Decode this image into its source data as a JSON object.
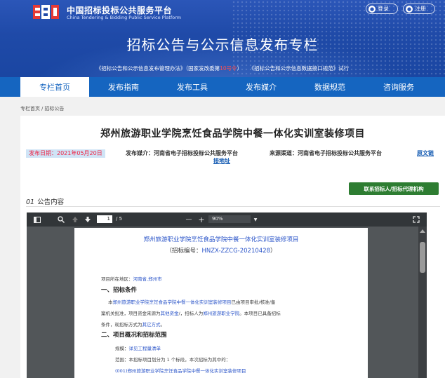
{
  "header": {
    "site_name_cn": "中国招标投标公共服务平台",
    "site_name_en": "China Tendering & Bidding Public Service Platform",
    "login": "登录",
    "register": "注册",
    "title": "招标公告与公示信息发布专栏",
    "policy_part1": "《招标公告和公示信息发布管理办法》（国家发改委第",
    "policy_red": "10号令",
    "policy_part2": "）",
    "policy_part3": "《招标公告和公示信息数据接口规范》试行"
  },
  "nav": {
    "items": [
      {
        "label": "专栏首页",
        "active": true
      },
      {
        "label": "发布指南",
        "active": false
      },
      {
        "label": "发布工具",
        "active": false
      },
      {
        "label": "发布媒介",
        "active": false
      },
      {
        "label": "数据规范",
        "active": false
      },
      {
        "label": "咨询服务",
        "active": false
      }
    ]
  },
  "breadcrumb": {
    "home": "专栏首页",
    "sep": "/",
    "current": "招标公告"
  },
  "article": {
    "title": "郑州旅游职业学院烹饪食品学院中餐一体化实训室装修项目",
    "publish_date": "发布日期：2021年05月20日",
    "source_label": "发布媒介：河南省电子招标投标公共服务平台",
    "channel_label": "来源渠道：河南省电子招标投标公共服务平台",
    "original_link": "原文链",
    "address_link": "接地址",
    "contact_button": "联系招标人/招标代理机构",
    "section_num": "01",
    "section_title": "公告内容"
  },
  "viewer": {
    "page_current": "1",
    "page_total": "/ 5",
    "zoom": "90%",
    "minus": "—",
    "plus": "+",
    "doc": {
      "title": "郑州旅游职业学院烹饪食品学院中餐一体化实训室装修项目",
      "code_prefix": "（招标编号：",
      "code": "HNZX-ZZCG-20210428",
      "code_suffix": "）",
      "location_label": "项目所在地区：",
      "location": "河南省,郑州市",
      "sec1": "一、招标条件",
      "cond1_a": "本",
      "cond1_proj": "郑州旅游职业学院烹饪食品学院中餐一体化实训室装修项目",
      "cond1_b": "已由项目审批/核准/备",
      "cond2_a": "案机关批准，项目资金来源为",
      "cond2_fund": "其他资金",
      "cond2_b": "/，招标人为",
      "cond2_owner": "郑州旅游职业学院",
      "cond2_c": "。本项目已具备招标",
      "cond3_a": "条件，现招标方式为",
      "cond3_method": "其它方式",
      "cond3_b": "。",
      "sec2": "二、项目概况和招标范围",
      "scale_label": "规模：",
      "scale": "详见工程量清单",
      "scope_line": "范围：本招标项目划分为 1 个标段，本次招标为其中的：",
      "lot": "(001)郑州旅游职业学院烹饪食品学院中餐一体化实训室装修项目"
    }
  },
  "colors": {
    "header_blue": "#1f4aa8",
    "nav_blue": "#1565c0",
    "contact_green": "#2e7d32",
    "date_red": "#e22244",
    "doc_blue": "#2b55c9"
  }
}
